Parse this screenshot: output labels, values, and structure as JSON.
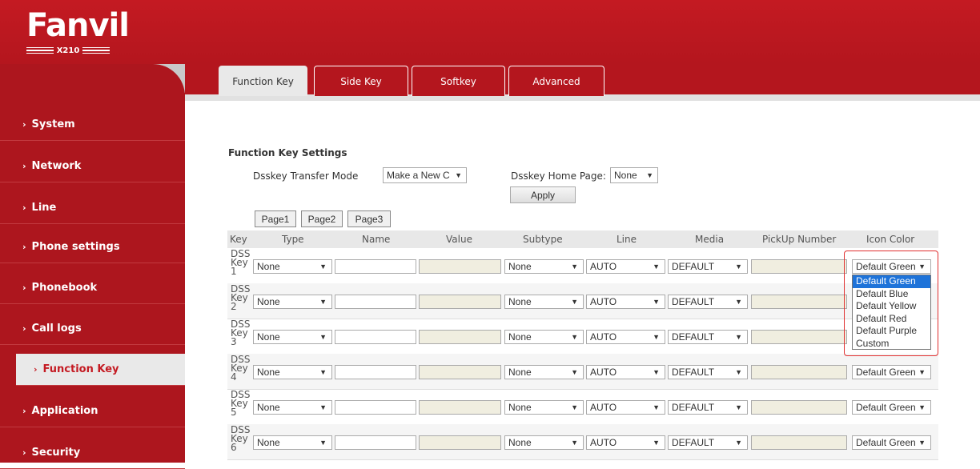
{
  "header": {
    "logo_text": "Fanvil",
    "model": "X210"
  },
  "sidebar": {
    "items": [
      {
        "label": "System"
      },
      {
        "label": "Network"
      },
      {
        "label": "Line"
      },
      {
        "label": "Phone settings"
      },
      {
        "label": "Phonebook"
      },
      {
        "label": "Call logs"
      },
      {
        "label": "Function Key",
        "active": true
      },
      {
        "label": "Application"
      },
      {
        "label": "Security"
      }
    ]
  },
  "tabs": [
    {
      "label": "Function Key",
      "active": true
    },
    {
      "label": "Side Key"
    },
    {
      "label": "Softkey"
    },
    {
      "label": "Advanced"
    }
  ],
  "settings": {
    "title": "Function Key Settings",
    "transfer_mode_label": "Dsskey Transfer Mode",
    "transfer_mode_value": "Make a New C",
    "home_page_label": "Dsskey Home Page:",
    "home_page_value": "None",
    "apply_label": "Apply"
  },
  "pages": [
    "Page1",
    "Page2",
    "Page3"
  ],
  "table": {
    "headers": [
      "Key",
      "Type",
      "Name",
      "Value",
      "Subtype",
      "Line",
      "Media",
      "PickUp Number",
      "Icon Color"
    ],
    "rows": [
      {
        "key": [
          "DSS",
          "Key",
          "1"
        ],
        "type": "None",
        "subtype": "None",
        "line": "AUTO",
        "media": "DEFAULT",
        "icon_color": "Default Green"
      },
      {
        "key": [
          "DSS",
          "Key",
          "2"
        ],
        "type": "None",
        "subtype": "None",
        "line": "AUTO",
        "media": "DEFAULT",
        "icon_color": ""
      },
      {
        "key": [
          "DSS",
          "Key",
          "3"
        ],
        "type": "None",
        "subtype": "None",
        "line": "AUTO",
        "media": "DEFAULT",
        "icon_color": ""
      },
      {
        "key": [
          "DSS",
          "Key",
          "4"
        ],
        "type": "None",
        "subtype": "None",
        "line": "AUTO",
        "media": "DEFAULT",
        "icon_color": "Default Green"
      },
      {
        "key": [
          "DSS",
          "Key",
          "5"
        ],
        "type": "None",
        "subtype": "None",
        "line": "AUTO",
        "media": "DEFAULT",
        "icon_color": "Default Green"
      },
      {
        "key": [
          "DSS",
          "Key",
          "6"
        ],
        "type": "None",
        "subtype": "None",
        "line": "AUTO",
        "media": "DEFAULT",
        "icon_color": "Default Green"
      }
    ]
  },
  "icon_color_dropdown": {
    "options": [
      "Default Green",
      "Default Blue",
      "Default Yellow",
      "Default Red",
      "Default Purple",
      "Custom"
    ],
    "selected": "Default Green"
  },
  "colors": {
    "brand_red": "#b4161e",
    "selection_blue": "#1e73d9",
    "highlight_red": "#e03030"
  }
}
